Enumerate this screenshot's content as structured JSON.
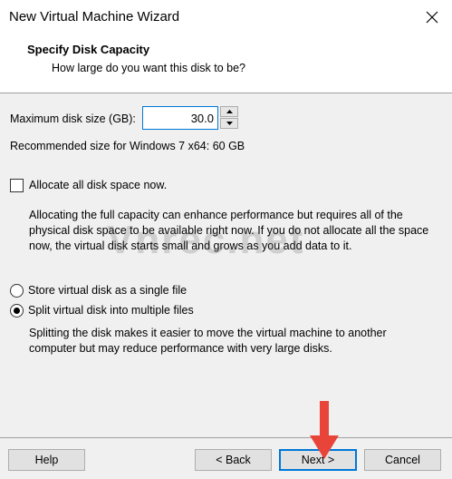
{
  "window": {
    "title": "New Virtual Machine Wizard",
    "close_icon": "close-icon"
  },
  "header": {
    "heading": "Specify Disk Capacity",
    "subheading": "How large do you want this disk to be?"
  },
  "disk": {
    "size_label": "Maximum disk size (GB):",
    "size_value": "30.0",
    "recommended": "Recommended size for Windows 7 x64: 60 GB"
  },
  "allocate": {
    "label": "Allocate all disk space now.",
    "checked": false,
    "description": "Allocating the full capacity can enhance performance but requires all of the physical disk space to be available right now. If you do not allocate all the space now, the virtual disk starts small and grows as you add data to it."
  },
  "storage": {
    "single_label": "Store virtual disk as a single file",
    "multiple_label": "Split virtual disk into multiple files",
    "selected": "multiple",
    "description": "Splitting the disk makes it easier to move the virtual machine to another computer but may reduce performance with very large disks."
  },
  "watermark": "Vnrec.net",
  "buttons": {
    "help": "Help",
    "back": "< Back",
    "next": "Next >",
    "cancel": "Cancel"
  },
  "colors": {
    "accent": "#0078d7",
    "annotation_arrow": "#e8443a"
  }
}
